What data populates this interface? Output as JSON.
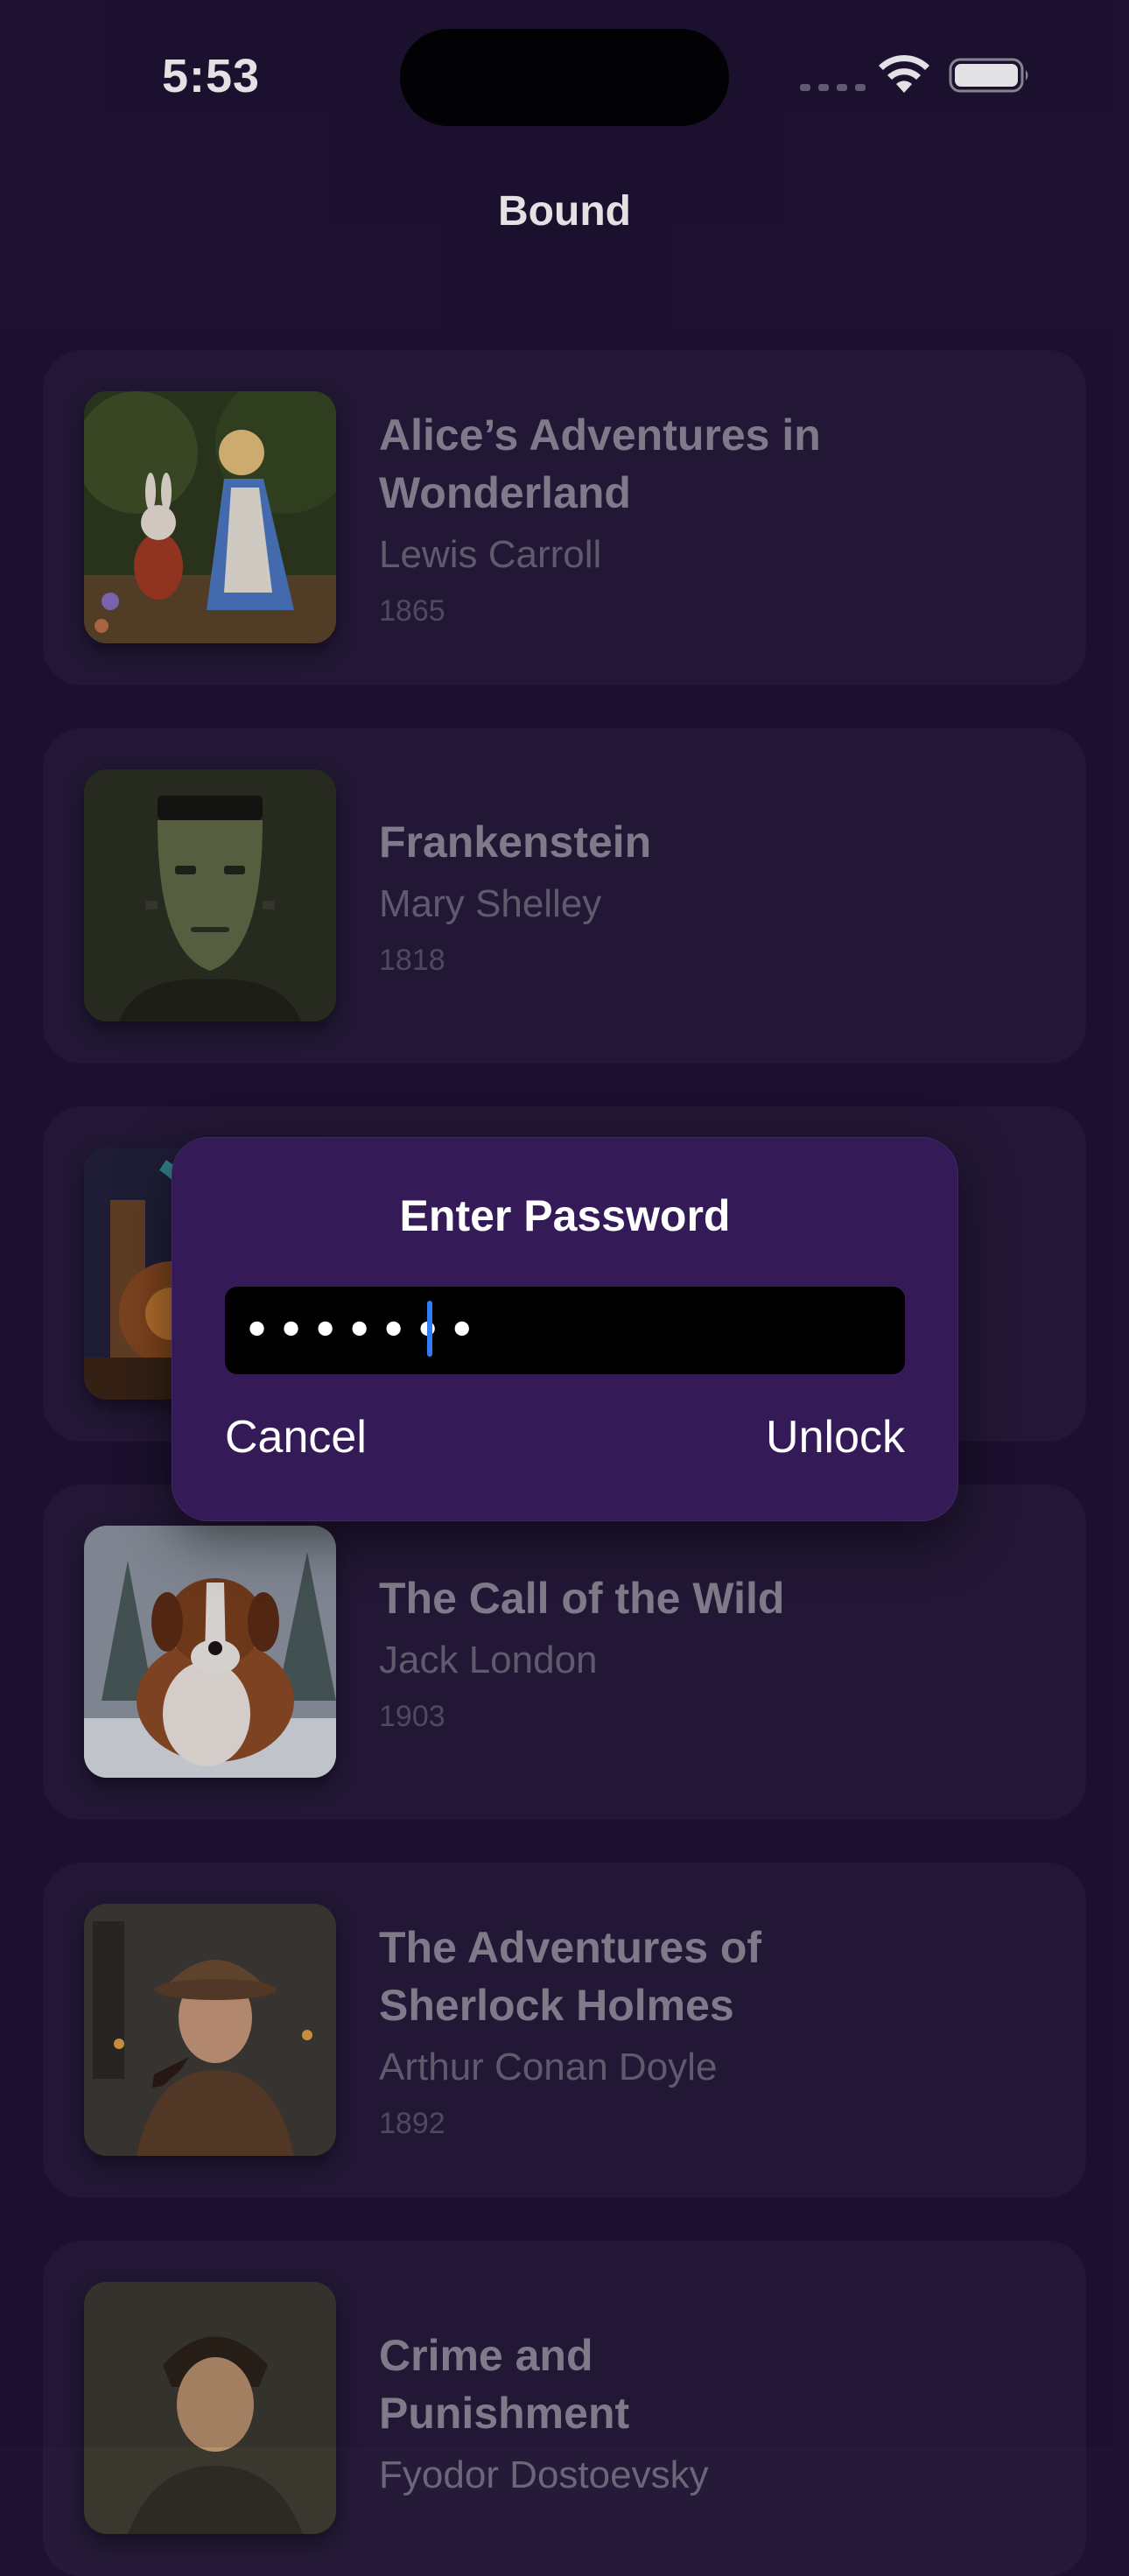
{
  "status_bar": {
    "time": "5:53"
  },
  "nav": {
    "title": "Bound"
  },
  "books": [
    {
      "title": "Alice’s Adventures in Wonderland",
      "author": "Lewis Carroll",
      "year": "1865",
      "cover_icon": "alice-rabbit-illustration"
    },
    {
      "title": "Frankenstein",
      "author": "Mary Shelley",
      "year": "1818",
      "cover_icon": "frankenstein-monster-portrait"
    },
    {
      "title": "",
      "author": "",
      "year": "",
      "cover_icon": "steampunk-machine-illustration"
    },
    {
      "title": "The Call of the Wild",
      "author": "Jack London",
      "year": "1903",
      "cover_icon": "dog-in-snow-portrait"
    },
    {
      "title": "The Adventures of Sherlock Holmes",
      "author": "Arthur Conan Doyle",
      "year": "1892",
      "cover_icon": "detective-with-pipe-portrait"
    },
    {
      "title": "Crime and Punishment",
      "author": "Fyodor Dostoevsky",
      "year": "",
      "cover_icon": "young-man-portrait"
    }
  ],
  "alert": {
    "title": "Enter Password",
    "password_value": "•••••••",
    "cancel_label": "Cancel",
    "unlock_label": "Unlock"
  },
  "colors": {
    "background": "#1d1230",
    "card": "#251a38",
    "alert_background": "#341b58",
    "caret": "#2f7cf6"
  }
}
